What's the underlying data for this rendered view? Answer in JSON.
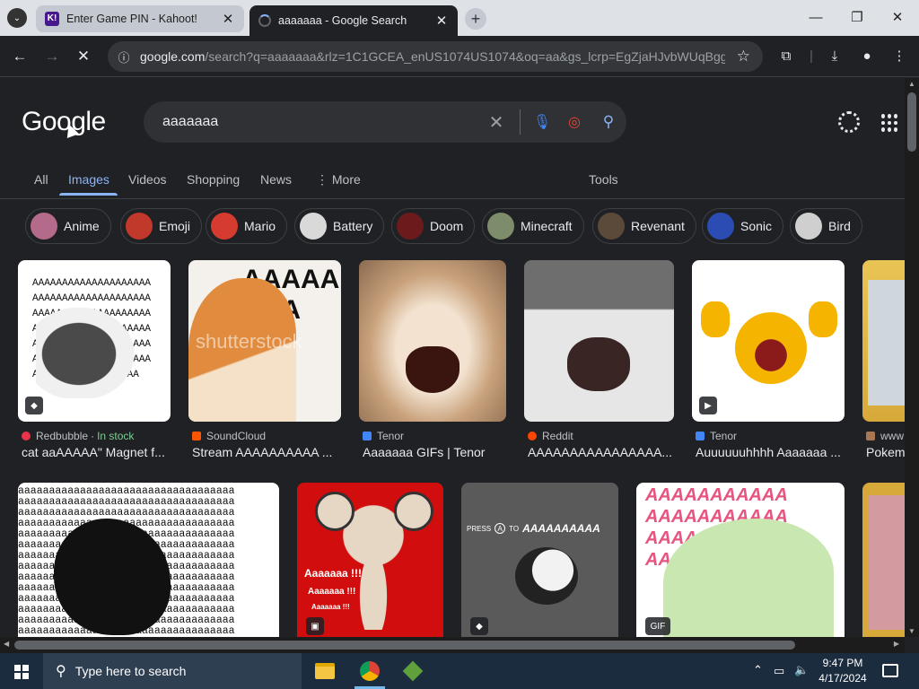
{
  "tabs": [
    {
      "title": "Enter Game PIN - Kahoot!",
      "favicon": "K!"
    },
    {
      "title": "aaaaaaa - Google Search"
    }
  ],
  "window_controls": {
    "minimize": "—",
    "maximize": "❐",
    "close": "✕"
  },
  "address": {
    "host": "google.com",
    "path": "/search?q=aaaaaaa&rlz=1C1GCEA_enUS1074US1074&oq=aa&gs_lcrp=EgZjaHJvbWUqBgg..."
  },
  "logo": "Google",
  "search": {
    "query": "aaaaaaa"
  },
  "nav_tabs": [
    {
      "label": "All"
    },
    {
      "label": "Images"
    },
    {
      "label": "Videos"
    },
    {
      "label": "Shopping"
    },
    {
      "label": "News"
    },
    {
      "label": "More"
    },
    {
      "label": "Tools"
    }
  ],
  "chips": [
    {
      "label": "Anime",
      "color": "#b46a8a"
    },
    {
      "label": "Emoji",
      "color": "#c0392b"
    },
    {
      "label": "Mario",
      "color": "#d63b2f"
    },
    {
      "label": "Battery",
      "color": "#d9d9d9"
    },
    {
      "label": "Doom",
      "color": "#6b1b1b"
    },
    {
      "label": "Minecraft",
      "color": "#7d8c6a"
    },
    {
      "label": "Revenant",
      "color": "#5b4a3a"
    },
    {
      "label": "Sonic",
      "color": "#2b4db3"
    },
    {
      "label": "Bird",
      "color": "#cfcfcf"
    }
  ],
  "results": [
    {
      "source": "Redbubble",
      "instock": "In stock",
      "title": "cat aaAAAAA\" Magnet f...",
      "sicon_color": "#e8334a",
      "badge": "tag-icon"
    },
    {
      "source": "SoundCloud",
      "title": "Stream AAAAAAAAAA ...",
      "sicon_color": "#ff5500",
      "overlay": "shutterstock",
      "bgtext": "AAAAAAAA"
    },
    {
      "source": "Tenor",
      "title": "Aaaaaaa GIFs | Tenor",
      "sicon_color": "#4285f4"
    },
    {
      "source": "Reddit",
      "title": "AAAAAAAAAAAAAAAA...",
      "sicon_color": "#ff4500"
    },
    {
      "source": "Tenor",
      "title": "Auuuuuuhhhh Aaaaaaa ...",
      "sicon_color": "#4285f4",
      "badge": "play-icon"
    },
    {
      "source": "www",
      "title": "Pokem",
      "sicon_color": "#aa7755"
    }
  ],
  "row2": [
    {
      "bgtext": "aaaaaaaaaaaaaaaaaaaaaaaaaaaaaaaaaaa"
    },
    {
      "text1": "Aaaaaaa !!!",
      "text2": "Aaaaaaa !!!",
      "text3": "Aaaaaaa !!!",
      "badge": "image-icon"
    },
    {
      "caption_a": "PRESS",
      "caption_b": "A",
      "caption_c": "TO",
      "caption_d": "AAAAAAAAAA",
      "badge": "tag-icon"
    },
    {
      "bgtext": "AAAAAAAAAAA",
      "badge": "GIF"
    },
    {}
  ],
  "taskbar": {
    "search_placeholder": "Type here to search",
    "time": "9:47 PM",
    "date": "4/17/2024"
  }
}
